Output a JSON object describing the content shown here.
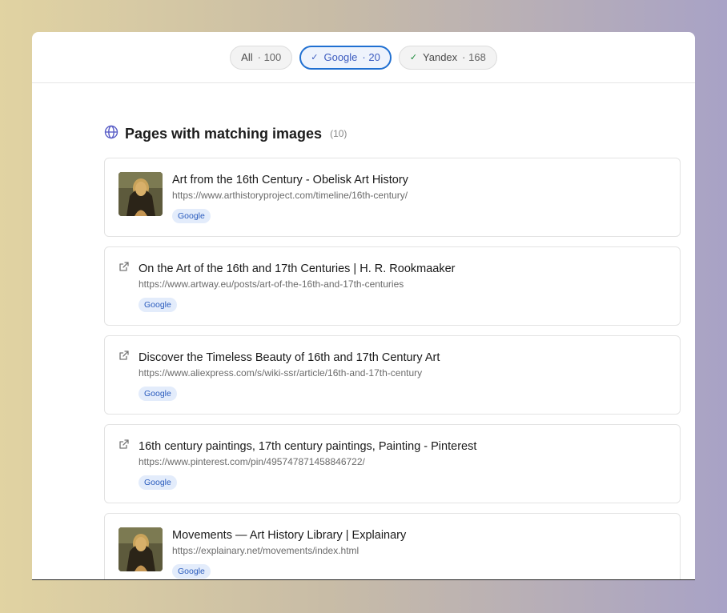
{
  "filters": [
    {
      "label": "All",
      "count": "· 100",
      "checked": false
    },
    {
      "label": "Google",
      "count": "· 20",
      "checked": true
    },
    {
      "label": "Yandex",
      "count": "· 168",
      "checked": true
    }
  ],
  "section": {
    "title": "Pages with matching images",
    "count": "(10)",
    "icon": "globe-icon"
  },
  "results": [
    {
      "title": "Art from the 16th Century - Obelisk Art History",
      "url": "https://www.arthistoryproject.com/timeline/16th-century/",
      "badge": "Google",
      "thumbnail": true
    },
    {
      "title": "On the Art of the 16th and 17th Centuries | H. R. Rookmaaker",
      "url": "https://www.artway.eu/posts/art-of-the-16th-and-17th-centuries",
      "badge": "Google",
      "thumbnail": false
    },
    {
      "title": "Discover the Timeless Beauty of 16th and 17th Century Art",
      "url": "https://www.aliexpress.com/s/wiki-ssr/article/16th-and-17th-century",
      "badge": "Google",
      "thumbnail": false
    },
    {
      "title": "16th century paintings, 17th century paintings, Painting - Pinterest",
      "url": "https://www.pinterest.com/pin/495747871458846722/",
      "badge": "Google",
      "thumbnail": false
    },
    {
      "title": "Movements — Art History Library | Explainary",
      "url": "https://explainary.net/movements/index.html",
      "badge": "Google",
      "thumbnail": true
    }
  ],
  "colors": {
    "accent": "#1f6fd1",
    "badge_bg": "#e3ecfb",
    "badge_text": "#2a5bbd"
  }
}
